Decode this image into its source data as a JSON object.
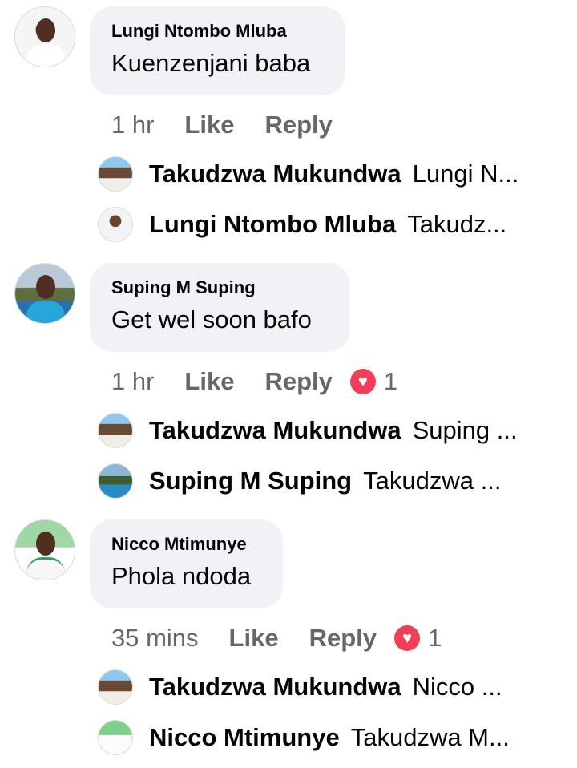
{
  "comments": [
    {
      "author": "Lungi Ntombo Mluba",
      "text": "Kuenzenjani baba",
      "time": "1 hr",
      "like": "Like",
      "reply": "Reply",
      "reaction_count": "",
      "replies": [
        {
          "author": "Takudzwa Mukundwa",
          "preview": "Lungi N..."
        },
        {
          "author": "Lungi Ntombo Mluba",
          "preview": "Takudz..."
        }
      ]
    },
    {
      "author": "Suping M Suping",
      "text": "Get wel soon bafo",
      "time": "1 hr",
      "like": "Like",
      "reply": "Reply",
      "reaction_count": "1",
      "replies": [
        {
          "author": "Takudzwa Mukundwa",
          "preview": "Suping ..."
        },
        {
          "author": "Suping M Suping",
          "preview": "Takudzwa ..."
        }
      ]
    },
    {
      "author": "Nicco Mtimunye",
      "text": "Phola ndoda",
      "time": "35 mins",
      "like": "Like",
      "reply": "Reply",
      "reaction_count": "1",
      "replies": [
        {
          "author": "Takudzwa Mukundwa",
          "preview": "Nicco ..."
        },
        {
          "author": "Nicco Mtimunye",
          "preview": "Takudzwa M..."
        }
      ]
    }
  ],
  "icons": {
    "heart": "love-reaction-icon",
    "avatar": "profile-avatar-icon"
  },
  "colors": {
    "bubble": "#f0f2f5",
    "meta_text": "#65676b",
    "heart": "#f33e58"
  }
}
